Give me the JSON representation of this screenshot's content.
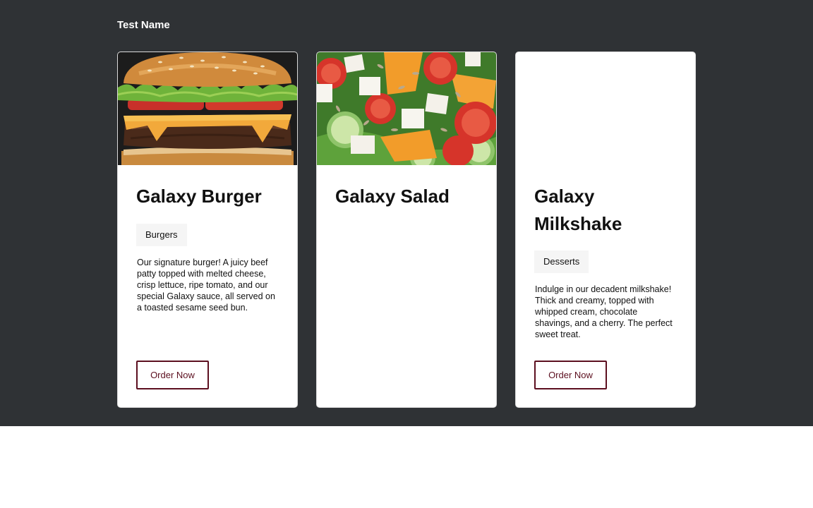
{
  "header": {
    "site_name": "Test Name"
  },
  "colors": {
    "background_dark": "#2f3235",
    "card_background": "#ffffff",
    "button_accent": "#5c0f1f",
    "tag_background": "#f5f5f5"
  },
  "cards": [
    {
      "title": "Galaxy Burger",
      "image": "burger-photo",
      "category": "Burgers",
      "description": "Our signature burger! A juicy beef patty topped with melted cheese, crisp lettuce, ripe tomato, and our special Galaxy sauce, all served on a toasted sesame seed bun.",
      "button_label": "Order Now"
    },
    {
      "title": "Galaxy Salad",
      "image": "salad-photo"
    },
    {
      "title": "Galaxy Milkshake",
      "category": "Desserts",
      "description": "Indulge in our decadent milkshake! Thick and creamy, topped with whipped cream, chocolate shavings, and a cherry. The perfect sweet treat.",
      "button_label": "Order Now"
    }
  ]
}
